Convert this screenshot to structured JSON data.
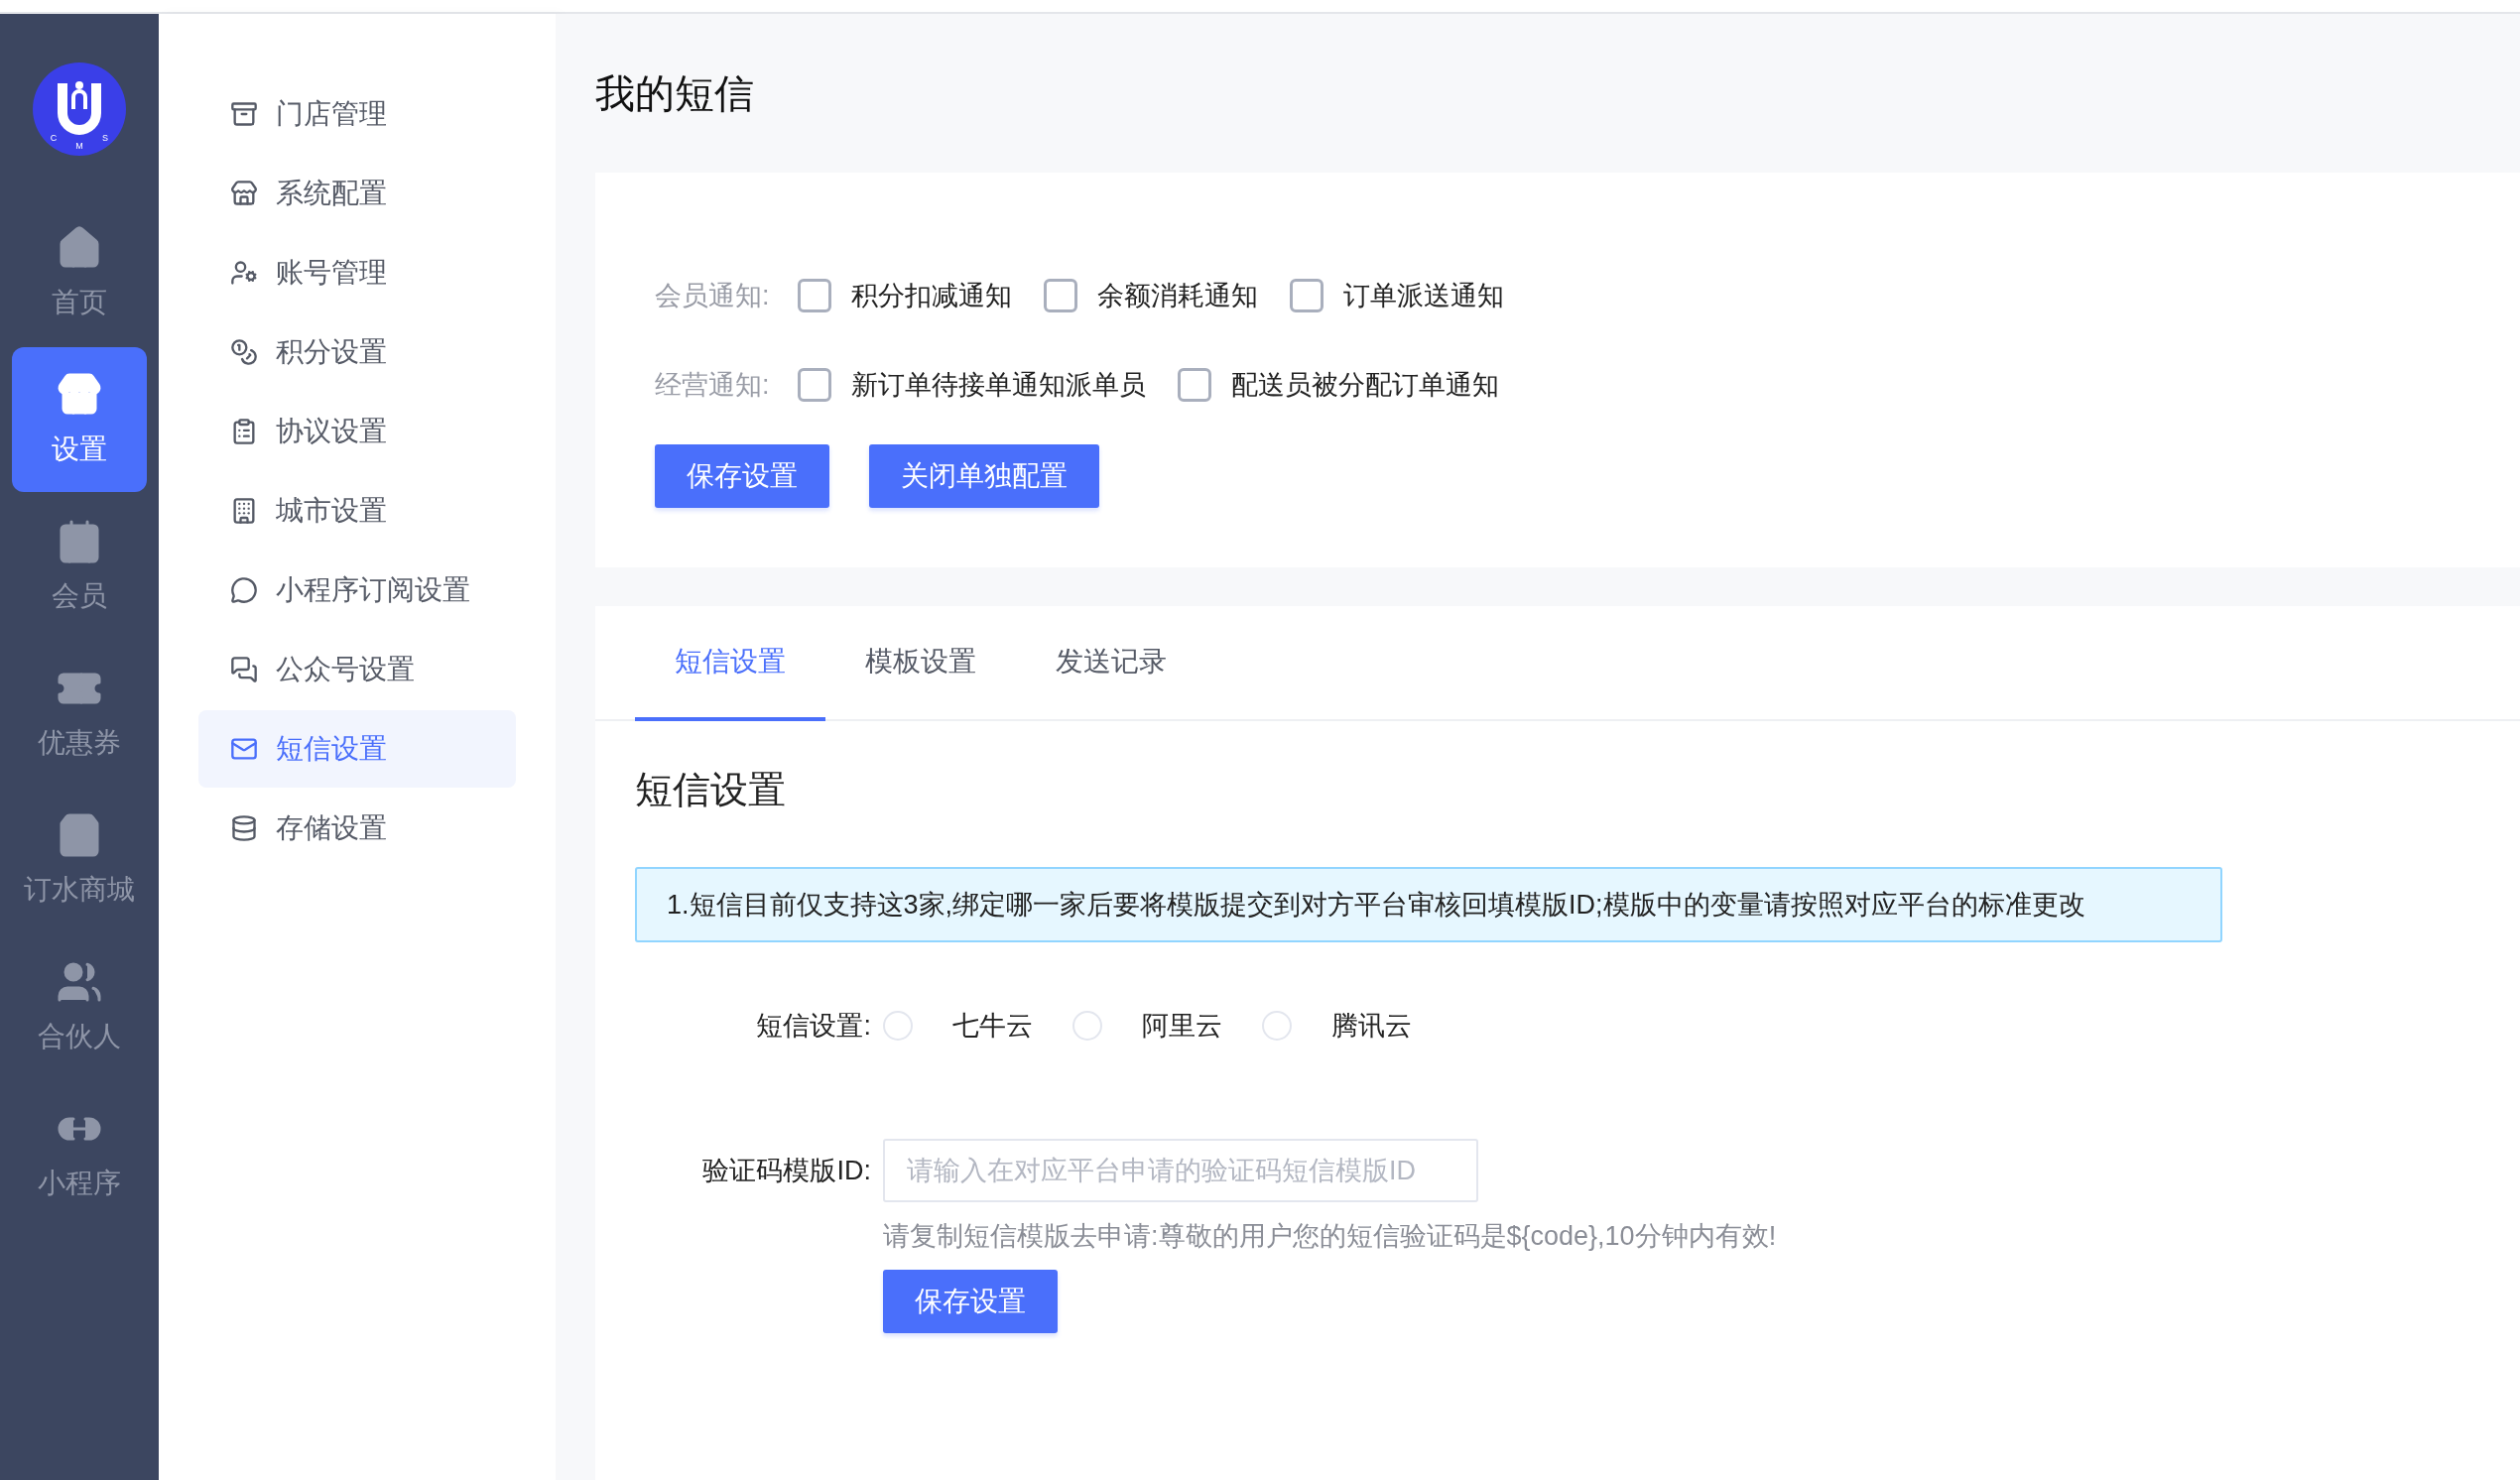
{
  "logo": {
    "letters": [
      "C",
      "M",
      "S"
    ]
  },
  "nav": [
    {
      "label": "首页",
      "selected": false
    },
    {
      "label": "设置",
      "selected": true
    },
    {
      "label": "会员",
      "selected": false
    },
    {
      "label": "优惠券",
      "selected": false
    },
    {
      "label": "订水商城",
      "selected": false
    },
    {
      "label": "合伙人",
      "selected": false
    },
    {
      "label": "小程序",
      "selected": false
    }
  ],
  "submenu": [
    {
      "label": "门店管理",
      "selected": false
    },
    {
      "label": "系统配置",
      "selected": false
    },
    {
      "label": "账号管理",
      "selected": false
    },
    {
      "label": "积分设置",
      "selected": false
    },
    {
      "label": "协议设置",
      "selected": false
    },
    {
      "label": "城市设置",
      "selected": false
    },
    {
      "label": "小程序订阅设置",
      "selected": false
    },
    {
      "label": "公众号设置",
      "selected": false
    },
    {
      "label": "短信设置",
      "selected": true
    },
    {
      "label": "存储设置",
      "selected": false
    }
  ],
  "page_title": "我的短信",
  "notifications": {
    "rows": [
      {
        "label": "会员通知:",
        "options": [
          {
            "label": "积分扣减通知",
            "checked": false
          },
          {
            "label": "余额消耗通知",
            "checked": false
          },
          {
            "label": "订单派送通知",
            "checked": false
          }
        ]
      },
      {
        "label": "经营通知:",
        "options": [
          {
            "label": "新订单待接单通知派单员",
            "checked": false
          },
          {
            "label": "配送员被分配订单通知",
            "checked": false
          }
        ]
      }
    ],
    "buttons": [
      "保存设置",
      "关闭单独配置"
    ]
  },
  "tabs": [
    {
      "label": "短信设置",
      "selected": true
    },
    {
      "label": "模板设置",
      "selected": false
    },
    {
      "label": "发送记录",
      "selected": false
    }
  ],
  "section_title": "短信设置",
  "alert": "1.短信目前仅支持这3家,绑定哪一家后要将模版提交到对方平台审核回填模版ID;模版中的变量请按照对应平台的标准更改",
  "form": {
    "provider": {
      "label": "短信设置:",
      "options": [
        {
          "label": "七牛云",
          "selected": false
        },
        {
          "label": "阿里云",
          "selected": false
        },
        {
          "label": "腾讯云",
          "selected": false
        }
      ]
    },
    "template_id": {
      "label": "验证码模版ID:",
      "placeholder": "请输入在对应平台申请的验证码短信模版ID",
      "hint": "请复制短信模版去申请:尊敬的用户您的短信验证码是${code},10分钟内有效!"
    },
    "button": "保存设置"
  }
}
